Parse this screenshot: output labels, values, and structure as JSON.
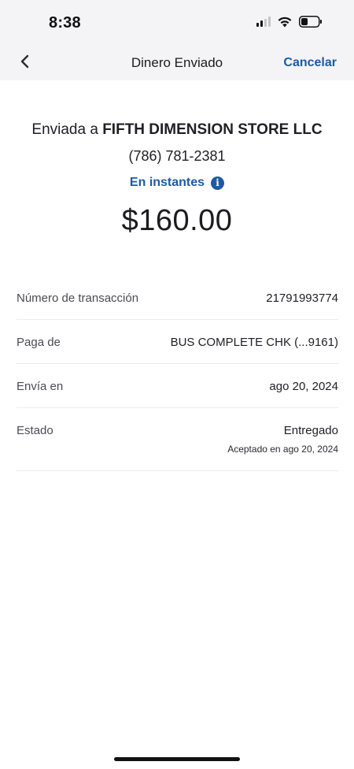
{
  "status_bar": {
    "time": "8:38",
    "icons": [
      "cellular-signal-icon",
      "wifi-icon",
      "battery-icon"
    ]
  },
  "nav": {
    "back_icon": "chevron-left-icon",
    "title": "Dinero Enviado",
    "cancel_label": "Cancelar"
  },
  "summary": {
    "sent_to_prefix": "Enviada a ",
    "recipient_name": "FIFTH DIMENSION STORE LLC",
    "recipient_phone": "(786) 781-2381",
    "speed_label": "En instantes",
    "speed_icon": "info-icon",
    "amount": "$160.00"
  },
  "details": {
    "transaction_label": "Número de transacción",
    "transaction_value": "21791993774",
    "pay_from_label": "Paga de",
    "pay_from_value": "BUS COMPLETE CHK (...9161)",
    "send_on_label": "Envía en",
    "send_on_value": "ago 20, 2024",
    "status_label": "Estado",
    "status_value": "Entregado",
    "status_detail": "Aceptado en ago 20, 2024"
  },
  "colors": {
    "accent": "#1f5aa3",
    "header_bg": "#f4f4f6",
    "divider": "#ececef"
  }
}
